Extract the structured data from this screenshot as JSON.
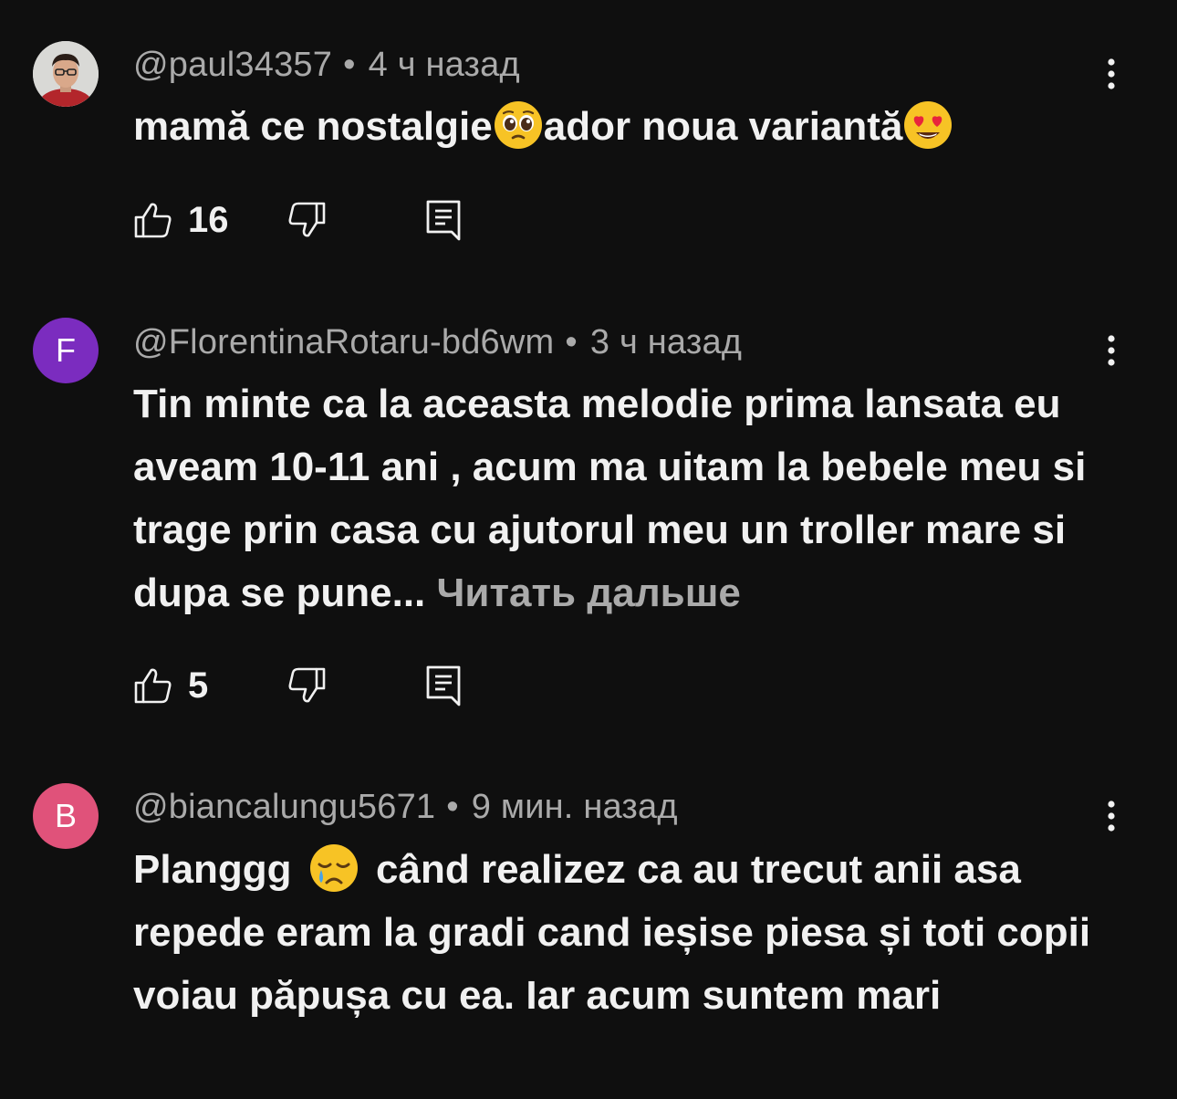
{
  "comments": [
    {
      "author": "@paul34357",
      "time": "4 ч назад",
      "separator": "•",
      "avatar_letter": "",
      "text_before": "mamă ce nostalgie",
      "emoji1": "pleading-face",
      "text_middle": "ador noua variantă",
      "emoji2": "heart-eyes-face",
      "likes": "16"
    },
    {
      "author": "@FlorentinaRotaru-bd6wm",
      "time": "3 ч назад",
      "separator": "•",
      "avatar_letter": "F",
      "avatar_color": "#7b2cbf",
      "text": "Tin minte ca la aceasta melodie prima lansata eu aveam 10-11 ani , acum ma uitam la bebele meu si trage prin casa cu ajutorul meu un troller mare si dupa se pune...",
      "read_more": "Читать дальше",
      "likes": "5"
    },
    {
      "author": "@biancalungu5671",
      "time": "9 мин. назад",
      "separator": "•",
      "avatar_letter": "B",
      "avatar_color": "#e0527a",
      "text_before": "Planggg",
      "emoji1": "crying-face",
      "text_after": "când realizez ca au trecut anii asa repede eram la gradi cand ieșise piesa și toti copii voiau păpușa cu ea. Iar acum suntem mari"
    }
  ]
}
